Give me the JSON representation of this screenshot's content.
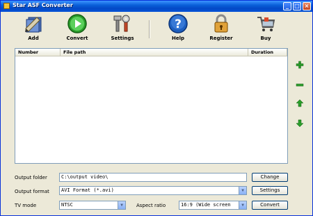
{
  "window": {
    "title": "Star ASF Converter"
  },
  "toolbar": {
    "add": "Add",
    "convert": "Convert",
    "settings": "Settings",
    "help": "Help",
    "register": "Register",
    "buy": "Buy"
  },
  "list": {
    "columns": [
      "Number",
      "File path",
      "Duration"
    ],
    "rows": []
  },
  "output_folder": {
    "label": "Output folder",
    "value": "C:\\output video\\",
    "button": "Change"
  },
  "output_format": {
    "label": "Output format",
    "value": "AVI Format (*.avi)",
    "button": "Settings"
  },
  "tv_mode": {
    "label": "TV mode",
    "value": "NTSC"
  },
  "aspect_ratio": {
    "label": "Aspect ratio",
    "value": "16:9     (Wide screen"
  },
  "convert_button": "Convert",
  "colors": {
    "titlebar": "#0a5fd8",
    "accent_green": "#2a9d2a"
  }
}
